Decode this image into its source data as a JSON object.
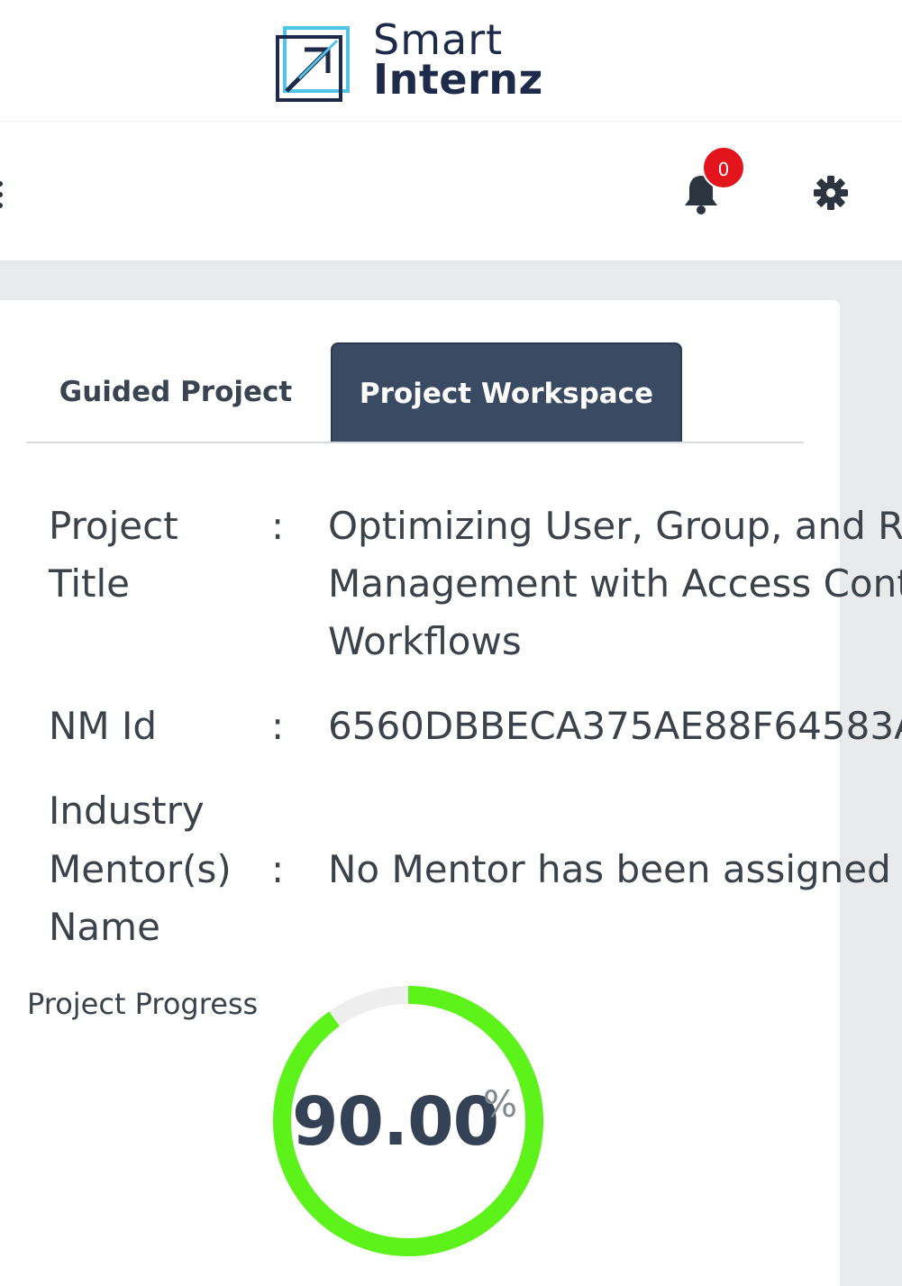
{
  "logo": {
    "line1": "Smart",
    "line2": "Internz"
  },
  "nav": {
    "notification_count": "0",
    "badge_color": "#e3141c"
  },
  "tabs": [
    {
      "label": "Guided Project",
      "active": false
    },
    {
      "label": "Project Workspace",
      "active": true
    }
  ],
  "details": {
    "project_title": {
      "label_lines": [
        "Project",
        "Title"
      ],
      "value_lines": [
        "Optimizing User, Group, and R",
        "Management with Access Cont",
        "Workflows"
      ]
    },
    "nm_id": {
      "label": "NM Id",
      "value": "6560DBBECA375AE88F64583A"
    },
    "mentor": {
      "label_lines": [
        "Industry",
        "Mentor(s)",
        "Name"
      ],
      "value": "No Mentor has been assigned"
    },
    "colon": ":"
  },
  "progress": {
    "label": "Project Progress",
    "value": "90.00",
    "percent_sign": "%",
    "fraction": 0.9,
    "color": "#5cf21a",
    "track_color": "#eeeeee"
  }
}
